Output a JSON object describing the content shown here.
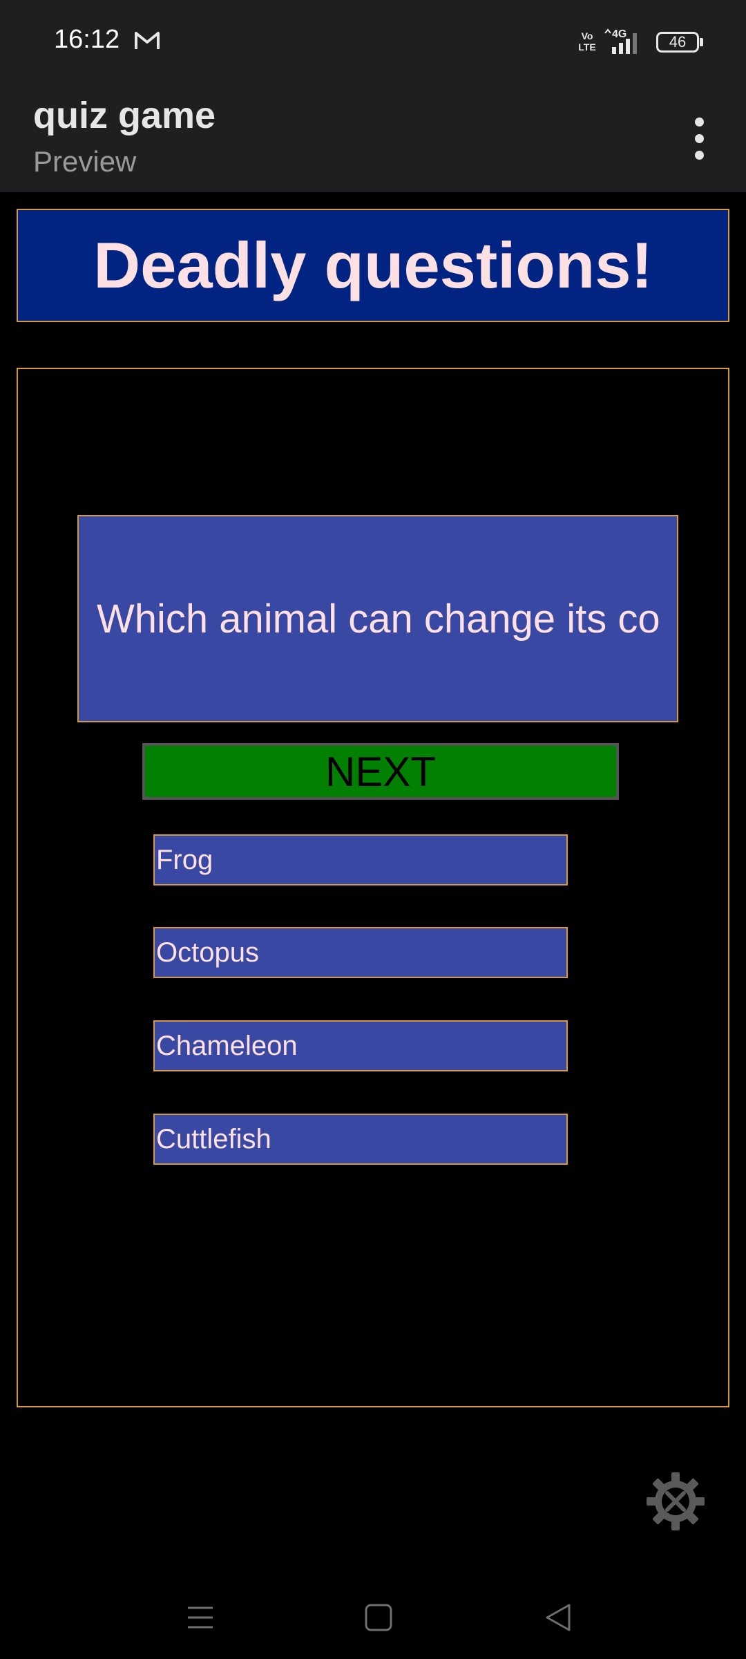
{
  "status_bar": {
    "time": "16:12",
    "volte_label": "Vo\nLTE",
    "network_label": "4G",
    "battery": "46",
    "icons": [
      "gmail-icon",
      "volte-icon",
      "signal-4g-icon",
      "battery-icon"
    ]
  },
  "app_bar": {
    "title": "quiz game",
    "subtitle": "Preview",
    "overflow_icon": "more-vert-icon"
  },
  "quiz": {
    "banner_title": "Deadly questions!",
    "question": "Which animal can change its color?",
    "next_label": "NEXT",
    "answers": [
      {
        "label": "Frog"
      },
      {
        "label": "Octopus"
      },
      {
        "label": "Chameleon"
      },
      {
        "label": "Cuttlefish"
      }
    ]
  },
  "settings": {
    "icon": "settings-tools-icon"
  },
  "nav_bar": {
    "items": [
      "menu-icon",
      "home-icon",
      "back-icon"
    ]
  },
  "colors": {
    "bar_background": "#1f1f21",
    "banner_background": "#012482",
    "question_background": "#3949a3",
    "accent_border": "#d69a3a",
    "next_button": "#018001",
    "text_pink": "#fde0e3"
  }
}
